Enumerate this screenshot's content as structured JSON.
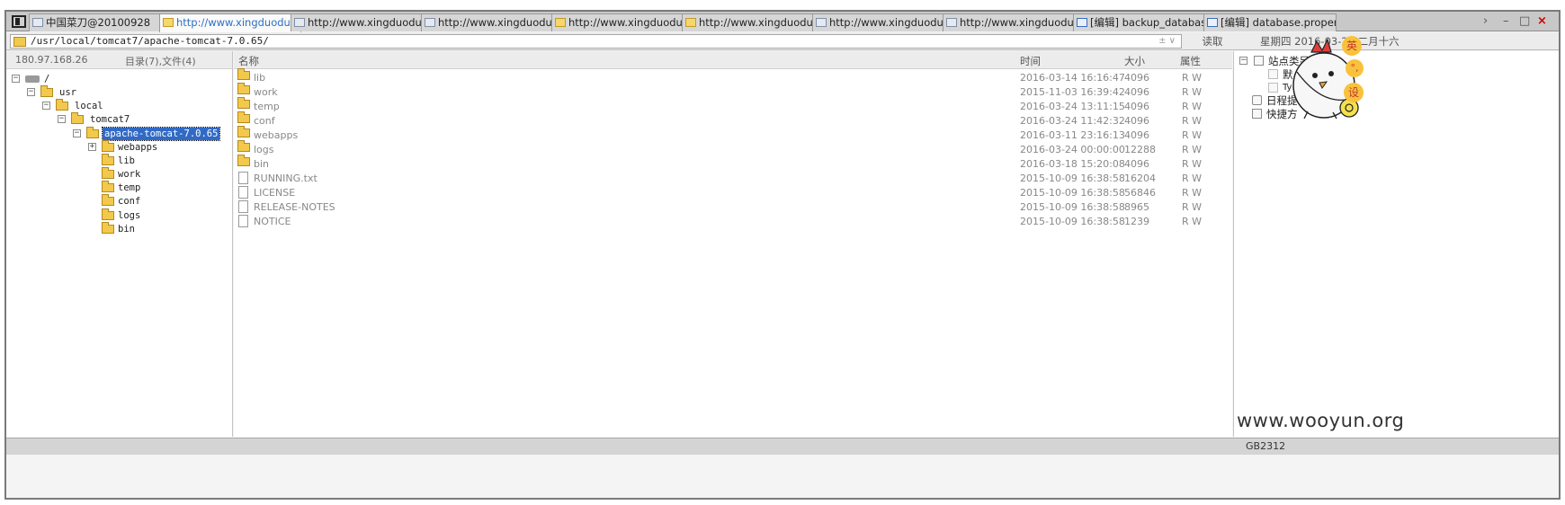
{
  "tabs": [
    {
      "label": "中国菜刀@20100928",
      "icon": "app-icon",
      "active": false
    },
    {
      "label": "http://www.xingduoduo.c...",
      "icon": "folder-icon",
      "active": true
    },
    {
      "label": "http://www.xingduoduo.c...",
      "icon": "window-icon",
      "active": false
    },
    {
      "label": "http://www.xingduoduo.c...",
      "icon": "window-icon",
      "active": false
    },
    {
      "label": "http://www.xingduoduo.c...",
      "icon": "folder-icon",
      "active": false
    },
    {
      "label": "http://www.xingduoduo.c...",
      "icon": "folder-icon",
      "active": false
    },
    {
      "label": "http://www.xingduoduo.c...",
      "icon": "window-icon",
      "active": false
    },
    {
      "label": "http://www.xingduoduo.c...",
      "icon": "window-icon",
      "active": false
    },
    {
      "label": "[编辑] backup_database....",
      "icon": "document-icon",
      "active": false
    },
    {
      "label": "[编辑] database.properties",
      "icon": "document-icon",
      "active": false
    }
  ],
  "address": {
    "path": "/usr/local/tomcat7/apache-tomcat-7.0.65/",
    "arrows": "± ∨",
    "read_label": "读取",
    "date": "星期四 2016-03-24 二月十六"
  },
  "left": {
    "ip": "180.97.168.26",
    "summary": "目录(7),文件(4)",
    "tree": [
      {
        "label": "/",
        "icon": "drive-icon",
        "expander": "−"
      },
      {
        "label": "usr",
        "icon": "folder-icon",
        "expander": "−"
      },
      {
        "label": "local",
        "icon": "folder-icon",
        "expander": "−"
      },
      {
        "label": "tomcat7",
        "icon": "folder-icon",
        "expander": "−"
      },
      {
        "label": "apache-tomcat-7.0.65",
        "icon": "folder-icon",
        "expander": "−",
        "selected": true
      },
      {
        "label": "webapps",
        "icon": "folder-icon",
        "expander": "+"
      },
      {
        "label": "lib",
        "icon": "folder-icon",
        "expander": ""
      },
      {
        "label": "work",
        "icon": "folder-icon",
        "expander": ""
      },
      {
        "label": "temp",
        "icon": "folder-icon",
        "expander": ""
      },
      {
        "label": "conf",
        "icon": "folder-icon",
        "expander": ""
      },
      {
        "label": "logs",
        "icon": "folder-icon",
        "expander": ""
      },
      {
        "label": "bin",
        "icon": "folder-icon",
        "expander": ""
      }
    ]
  },
  "files": {
    "columns": {
      "name": "名称",
      "time": "时间",
      "size": "大小",
      "attr": "属性"
    },
    "rows": [
      {
        "name": "lib",
        "type": "folder",
        "time": "2016-03-14 16:16:47",
        "size": "4096",
        "attr": "R W"
      },
      {
        "name": "work",
        "type": "folder",
        "time": "2015-11-03 16:39:42",
        "size": "4096",
        "attr": "R W"
      },
      {
        "name": "temp",
        "type": "folder",
        "time": "2016-03-24 13:11:15",
        "size": "4096",
        "attr": "R W"
      },
      {
        "name": "conf",
        "type": "folder",
        "time": "2016-03-24 11:42:32",
        "size": "4096",
        "attr": "R W"
      },
      {
        "name": "webapps",
        "type": "folder",
        "time": "2016-03-11 23:16:13",
        "size": "4096",
        "attr": "R W"
      },
      {
        "name": "logs",
        "type": "folder",
        "time": "2016-03-24 00:00:00",
        "size": "12288",
        "attr": "R W"
      },
      {
        "name": "bin",
        "type": "folder",
        "time": "2016-03-18 15:20:08",
        "size": "4096",
        "attr": "R W"
      },
      {
        "name": "RUNNING.txt",
        "type": "file",
        "time": "2015-10-09 16:38:58",
        "size": "16204",
        "attr": "R W"
      },
      {
        "name": "LICENSE",
        "type": "file",
        "time": "2015-10-09 16:38:58",
        "size": "56846",
        "attr": "R W"
      },
      {
        "name": "RELEASE-NOTES",
        "type": "file",
        "time": "2015-10-09 16:38:58",
        "size": "8965",
        "attr": "R W"
      },
      {
        "name": "NOTICE",
        "type": "file",
        "time": "2015-10-09 16:38:58",
        "size": "1239",
        "attr": "R W"
      }
    ]
  },
  "right": {
    "items": [
      {
        "label": "站点类另",
        "expander": "−"
      },
      {
        "label": "默",
        "expander": ""
      },
      {
        "label": "Ty",
        "expander": ""
      },
      {
        "label": "日程提",
        "expander": ""
      },
      {
        "label": "快捷方",
        "expander": ""
      }
    ],
    "mascot_badges": [
      "英",
      "°,",
      "设"
    ]
  },
  "status": {
    "encoding": "GB2312"
  },
  "watermark": "www.wooyun.org",
  "colors": {
    "selection": "#316ac5",
    "active_tab_text": "#2b70c6",
    "folder": "#f2c94c"
  }
}
